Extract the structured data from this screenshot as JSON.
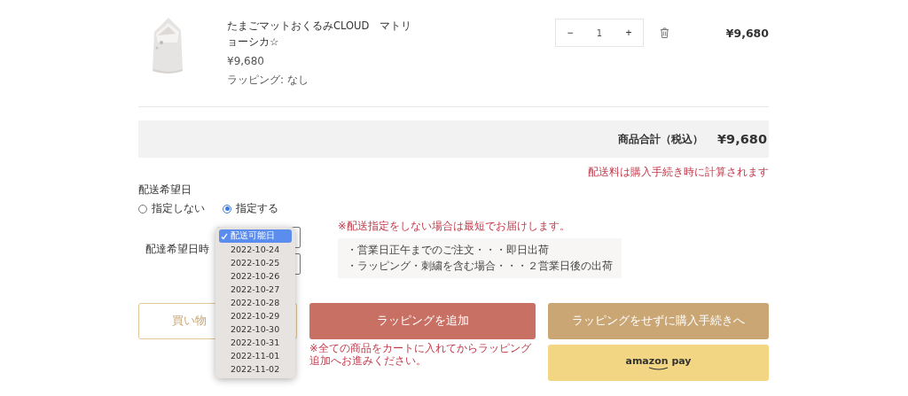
{
  "product": {
    "name": "たまごマットおくるみCLOUD　マトリョーシカ☆",
    "unit_price": "¥9,680",
    "wrapping": "ラッピング: なし",
    "quantity": {
      "minus": "−",
      "value": "1",
      "plus": "+"
    },
    "line_total": "¥9,680"
  },
  "summary": {
    "label": "商品合計（税込）",
    "total": "¥9,680",
    "shipping_note": "配送料は購入手続き時に計算されます"
  },
  "delivery": {
    "title": "配送希望日",
    "options": [
      {
        "label": "指定しない",
        "selected": false
      },
      {
        "label": "指定する",
        "selected": true
      }
    ],
    "row_label": "配達希望日時",
    "notice": "※配送指定をしない場合は最短でお届けします。",
    "info_lines": [
      "・営業日正午までのご注文・・・即日出荷",
      "・ラッピング・刺繍を含む場合・・・２営業日後の出荷"
    ],
    "dropdown": {
      "options": [
        {
          "label": "配送可能日",
          "selected": true
        },
        {
          "label": "2022-10-24",
          "selected": false
        },
        {
          "label": "2022-10-25",
          "selected": false
        },
        {
          "label": "2022-10-26",
          "selected": false
        },
        {
          "label": "2022-10-27",
          "selected": false
        },
        {
          "label": "2022-10-28",
          "selected": false
        },
        {
          "label": "2022-10-29",
          "selected": false
        },
        {
          "label": "2022-10-30",
          "selected": false
        },
        {
          "label": "2022-10-31",
          "selected": false
        },
        {
          "label": "2022-11-01",
          "selected": false
        },
        {
          "label": "2022-11-02",
          "selected": false
        }
      ]
    }
  },
  "buttons": [
    {
      "label": "買い物",
      "kind": "outline"
    },
    {
      "label": "ラッピングを追加",
      "kind": "wrap"
    },
    {
      "label": "ラッピングをせずに購入手続きへ",
      "kind": "checkout"
    },
    {
      "label": "amazon pay",
      "kind": "amazon"
    }
  ],
  "wrap_note": "※全ての商品をカートに入れてからラッピング追加へお進みください。"
}
